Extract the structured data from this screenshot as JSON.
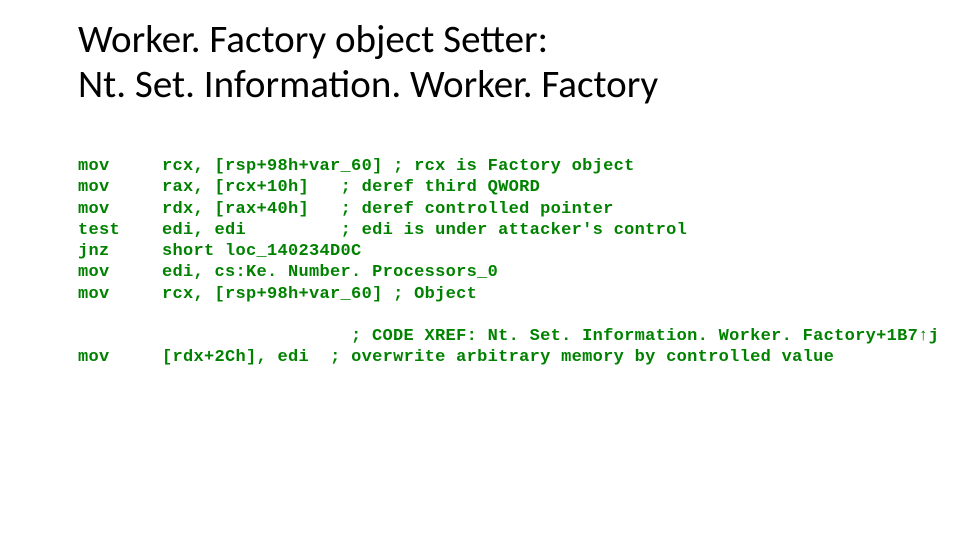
{
  "title_line1": "Worker. Factory object Setter:",
  "title_line2": "Nt. Set. Information. Worker. Factory",
  "asm": {
    "lines": [
      {
        "m": "mov",
        "ops": "rcx, [rsp+98h+var_60]",
        "cmt": "; rcx is Factory object"
      },
      {
        "m": "mov",
        "ops": "rax, [rcx+10h]",
        "cmt": "; deref third QWORD"
      },
      {
        "m": "mov",
        "ops": "rdx, [rax+40h]",
        "cmt": "; deref controlled pointer"
      },
      {
        "m": "test",
        "ops": "edi, edi",
        "cmt": "; edi is under attacker's control"
      },
      {
        "m": "jnz",
        "ops": "short loc_140234D0C",
        "cmt": ""
      },
      {
        "m": "mov",
        "ops": "edi, cs:Ke. Number. Processors_0",
        "cmt": ""
      },
      {
        "m": "mov",
        "ops": "rcx, [rsp+98h+var_60]",
        "cmt": "; Object"
      }
    ],
    "xref": "; CODE XREF: Nt. Set. Information. Worker. Factory+1B7↑j",
    "tail": {
      "m": "mov",
      "ops": "[rdx+2Ch], edi",
      "cmt": "; overwrite arbitrary memory by controlled value"
    }
  }
}
